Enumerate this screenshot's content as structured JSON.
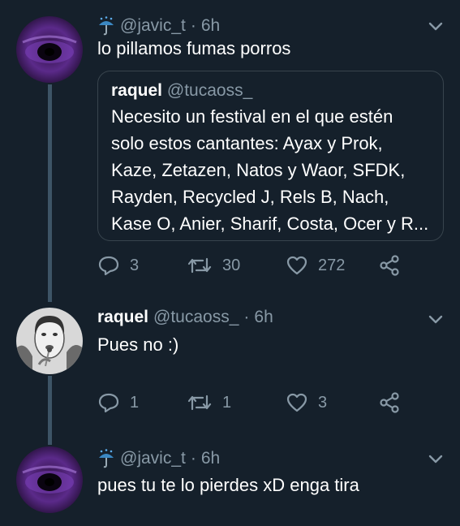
{
  "tweets": [
    {
      "emoji": "umbrella-with-rain-icon",
      "handle": "@javic_t",
      "separator": "·",
      "time": "6h",
      "text": "lo pillamos fumas porros",
      "quote": {
        "name": "raquel",
        "handle": "@tucaoss_",
        "lines": [
          "Necesito un festival en el que estén",
          "solo estos cantantes: Ayax y Prok,",
          "Kaze, Zetazen, Natos y Waor, SFDK,",
          "Rayden, Recycled J, Rels B, Nach,",
          "Kase O, Anier, Sharif, Costa, Ocer y R..."
        ]
      },
      "replies": "3",
      "retweets": "30",
      "likes": "272"
    },
    {
      "name": "raquel",
      "handle": "@tucaoss_",
      "separator": "·",
      "time": "6h",
      "text": "Pues no :)",
      "replies": "1",
      "retweets": "1",
      "likes": "3"
    },
    {
      "emoji": "umbrella-with-rain-icon",
      "handle": "@javic_t",
      "separator": "·",
      "time": "6h",
      "text": "pues tu te lo pierdes xD enga tira"
    }
  ],
  "colors": {
    "background": "#15202b",
    "secondary_text": "#8899a6",
    "border": "#38444d",
    "thread_line": "#3d5466"
  }
}
